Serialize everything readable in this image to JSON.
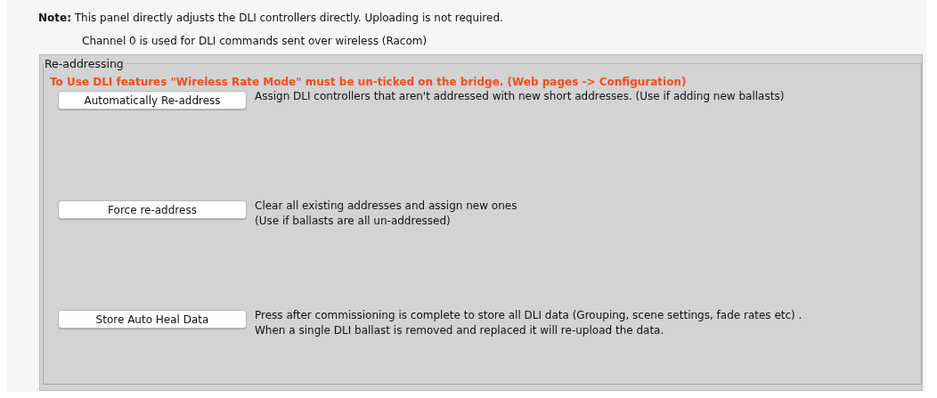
{
  "note": {
    "text": "**Note:** This panel directly adjusts the DLI controllers directly. Uploading is not required.",
    "channel_info": "Channel 0 is used for DLI commands sent over wireless (Racom)"
  },
  "group": {
    "title": "Re-addressing",
    "warning": "To Use DLI features \"Wireless Rate Mode\" must be un-ticked on the bridge. (Web pages -> Configuration)",
    "actions": [
      {
        "button": "Automatically Re-address",
        "description": [
          "Assign DLI controllers that aren't addressed with new short addresses. (Use if adding new ballasts)"
        ]
      },
      {
        "button": "Force re-address",
        "description": [
          "Clear all existing addresses and assign new ones",
          "(Use if ballasts are all un-addressed)"
        ]
      },
      {
        "button": "Store Auto Heal Data",
        "description": [
          "Press after commissioning is complete to store all DLI data (Grouping, scene settings, fade rates etc) .",
          "When a single DLI ballast is removed and replaced it will re-upload the data."
        ]
      }
    ]
  }
}
